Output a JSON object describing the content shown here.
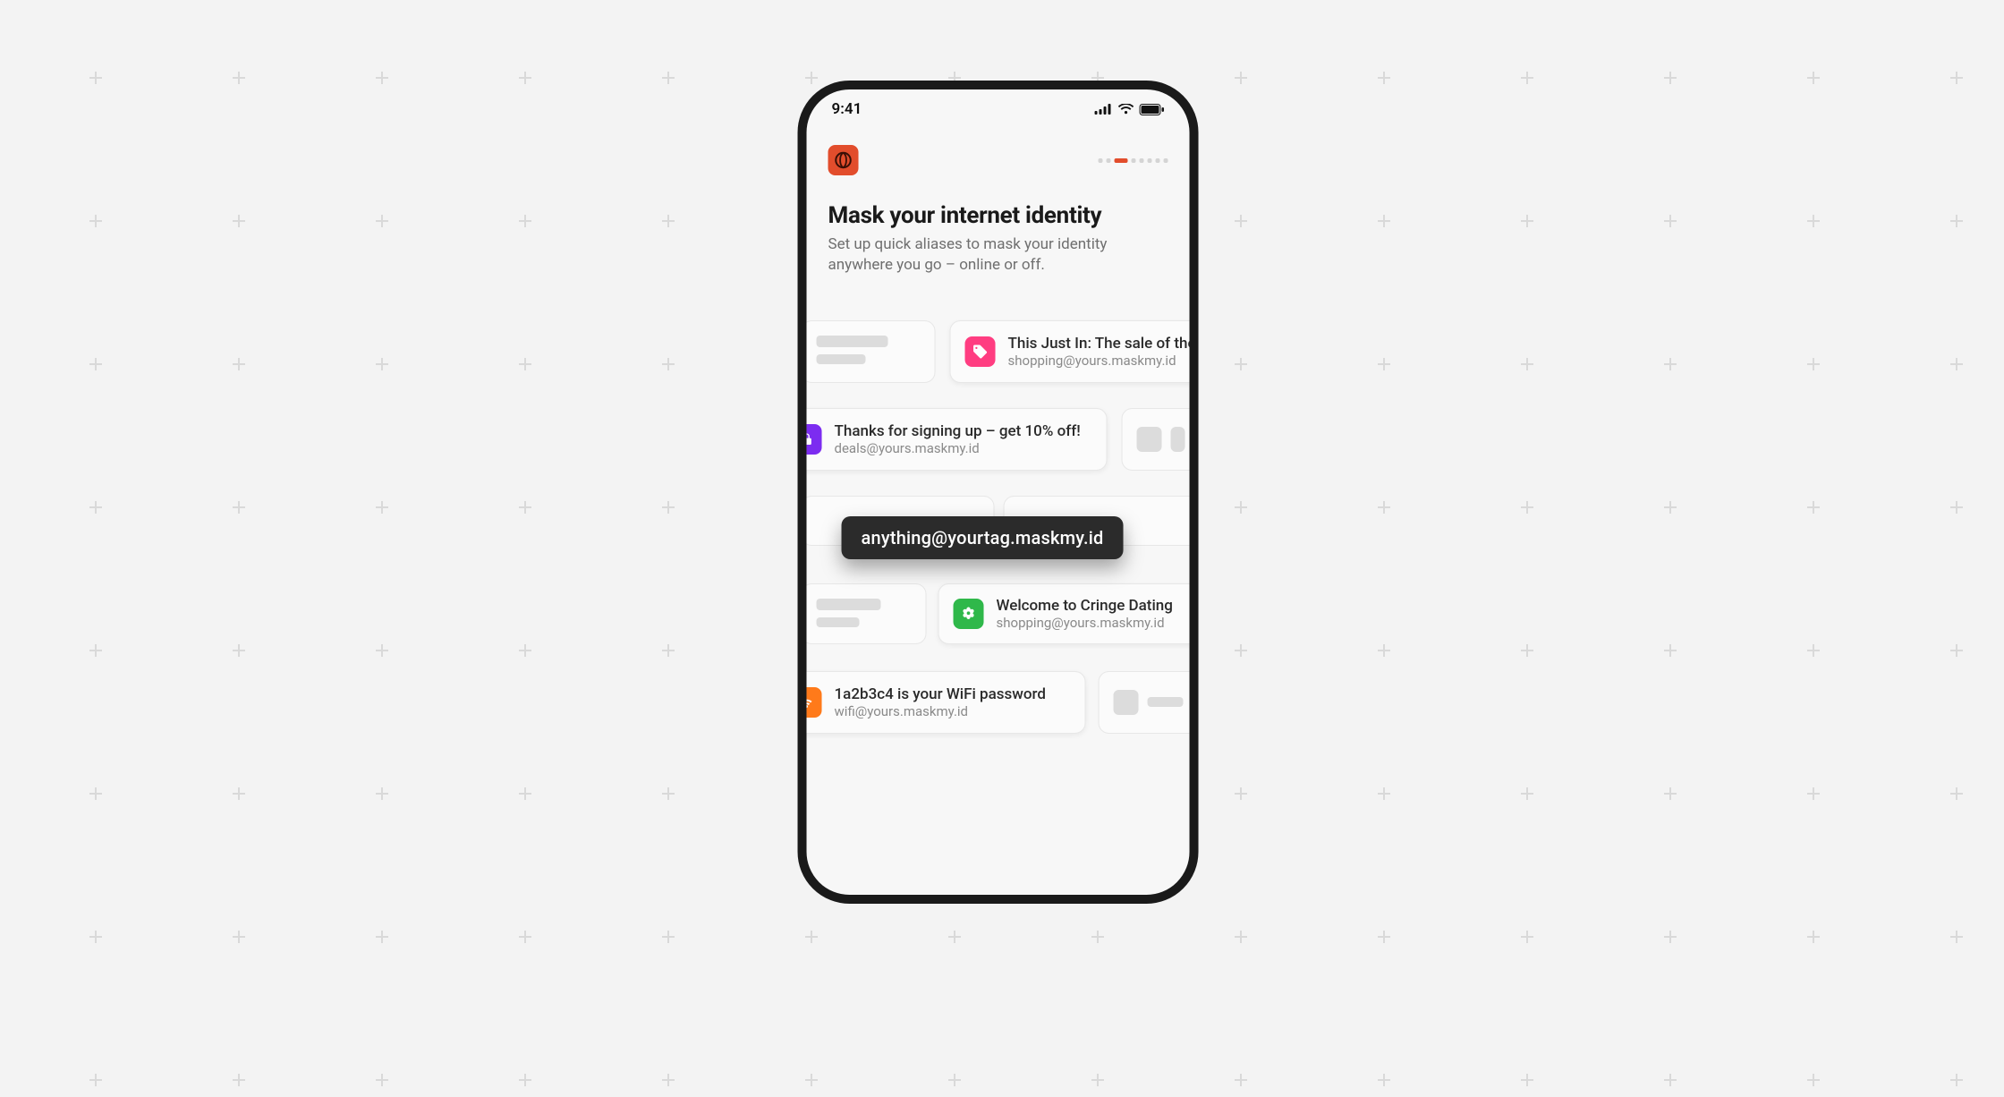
{
  "status": {
    "time": "9:41"
  },
  "header": {
    "title": "Mask your internet identity",
    "subtitle": "Set up quick aliases to mask your identity anywhere you go – online or off."
  },
  "mask_pill": "anything@yourtag.maskmy.id",
  "cards": {
    "sale": {
      "title": "This Just In: The sale of the",
      "sub": "shopping@yours.maskmy.id"
    },
    "signup": {
      "title": "Thanks for signing up – get 10% off!",
      "sub": "deals@yours.maskmy.id"
    },
    "dating": {
      "title": "Welcome to Cringe Dating",
      "sub": "shopping@yours.maskmy.id"
    },
    "wifi": {
      "title": "1a2b3c4 is your WiFi password",
      "sub": "wifi@yours.maskmy.id"
    }
  },
  "pager": {
    "total": 8,
    "active_index": 2
  }
}
